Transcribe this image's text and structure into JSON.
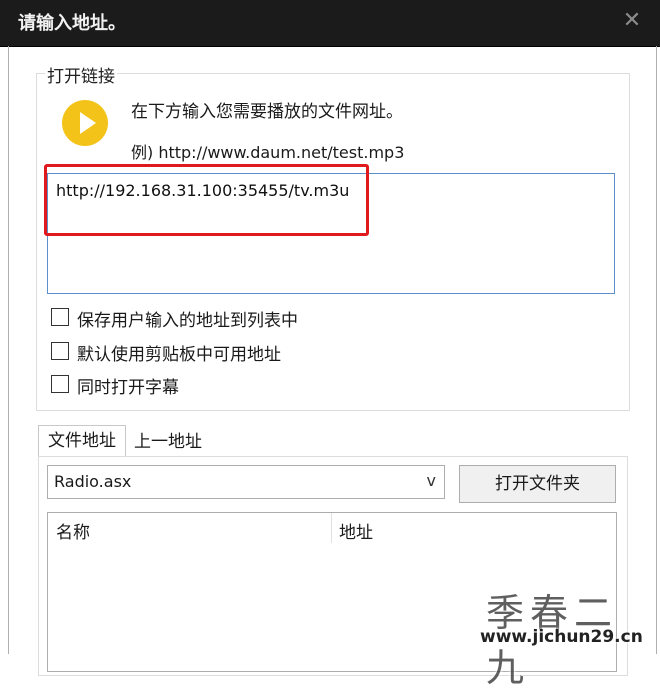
{
  "window": {
    "title": "请输入地址。",
    "close_icon": "✕"
  },
  "open_link_group": {
    "title": "打开链接",
    "icon": "play-icon",
    "instruction": "在下方输入您需要播放的文件网址。",
    "example": "例) http://www.daum.net/test.mp3",
    "url_value": "http://192.168.31.100:35455/tv.m3u",
    "highlight_color": "#e0191d"
  },
  "checkboxes": [
    {
      "label": "保存用户输入的地址到列表中",
      "checked": false
    },
    {
      "label": "默认使用剪贴板中可用地址",
      "checked": false
    },
    {
      "label": "同时打开字幕",
      "checked": false
    }
  ],
  "tabs": [
    {
      "label": "文件地址",
      "active": true
    },
    {
      "label": "上一地址",
      "active": false
    }
  ],
  "file_panel": {
    "selected_file": "Radio.asx",
    "dropdown_chevron": "v",
    "open_folder_button": "打开文件夹",
    "columns": [
      "名称",
      "地址"
    ]
  },
  "watermark": {
    "brand": "季春二九",
    "url": "www.jichun29.cn"
  }
}
